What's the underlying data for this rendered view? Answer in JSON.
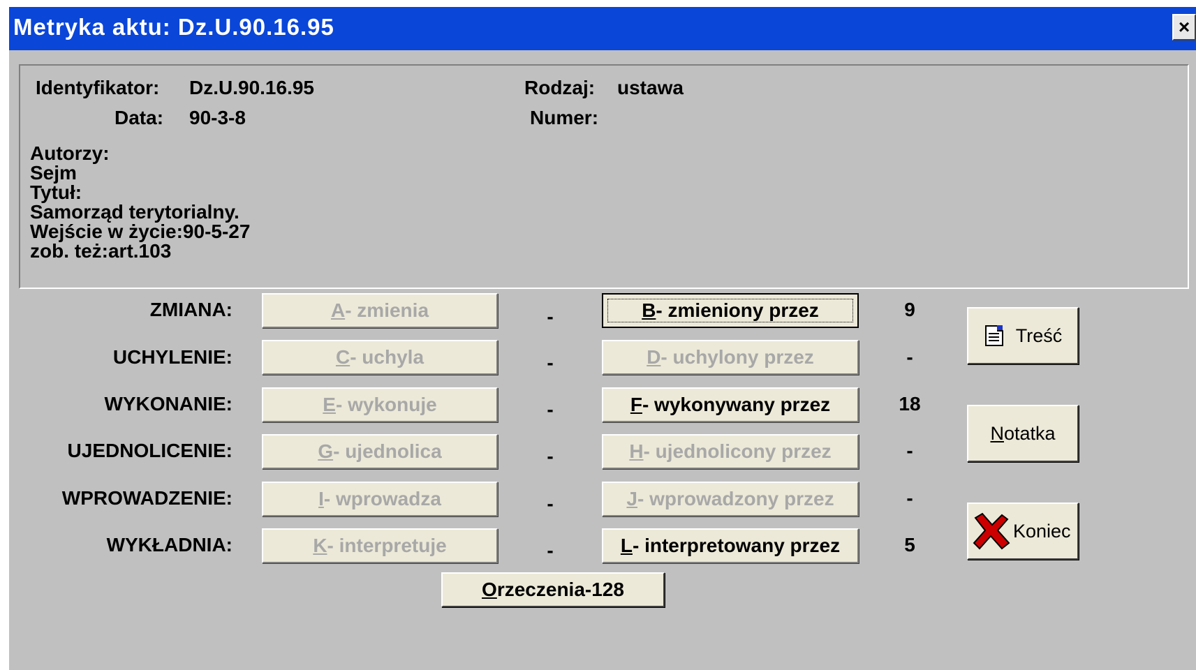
{
  "window": {
    "title": "Metryka aktu: Dz.U.90.16.95",
    "close_glyph": "×"
  },
  "info": {
    "identyfikator_label": "Identyfikator:",
    "identyfikator_value": "Dz.U.90.16.95",
    "data_label": "Data:",
    "data_value": "90-3-8",
    "rodzaj_label": "Rodzaj:",
    "rodzaj_value": "ustawa",
    "numer_label": "Numer:",
    "numer_value": "",
    "description_lines": [
      "Autorzy:",
      "Sejm",
      "Tytuł:",
      "Samorząd terytorialny.",
      "Wejście w życie:90-5-27",
      "zob. też:art.103"
    ]
  },
  "rows": [
    {
      "label": "ZMIANA:",
      "left_key": "A",
      "left_text": " - zmienia",
      "left_count": "-",
      "right_key": "B",
      "right_text": " - zmieniony przez",
      "right_count": "9"
    },
    {
      "label": "UCHYLENIE:",
      "left_key": "C",
      "left_text": " - uchyla",
      "left_count": "-",
      "right_key": "D",
      "right_text": " - uchylony przez",
      "right_count": "-"
    },
    {
      "label": "WYKONANIE:",
      "left_key": "E",
      "left_text": " - wykonuje",
      "left_count": "-",
      "right_key": "F",
      "right_text": " - wykonywany przez",
      "right_count": "18"
    },
    {
      "label": "UJEDNOLICENIE:",
      "left_key": "G",
      "left_text": " - ujednolica",
      "left_count": "-",
      "right_key": "H",
      "right_text": " - ujednolicony przez",
      "right_count": "-"
    },
    {
      "label": "WPROWADZENIE:",
      "left_key": "I",
      "left_text": " - wprowadza",
      "left_count": "-",
      "right_key": "J",
      "right_text": " - wprowadzony przez",
      "right_count": "-"
    },
    {
      "label": "WYKŁADNIA:",
      "left_key": "K",
      "left_text": " - interpretuje",
      "left_count": "-",
      "right_key": "L",
      "right_text": " - interpretowany przez",
      "right_count": "5"
    }
  ],
  "buttons": {
    "orzeczenia_key": "O",
    "orzeczenia_rest": "rzeczenia-128",
    "tresc_label": "Treść",
    "notatka_key": "N",
    "notatka_rest": "otatka",
    "koniec_label": "Koniec"
  },
  "colors": {
    "title_bar": "#0a46d8",
    "dialog_bg": "#c0c0c0",
    "button_face": "#ece9d8",
    "disabled_text": "#a8a8a8",
    "close_x": "#cc0000"
  },
  "icons": {
    "tresc": "document-icon",
    "koniec": "red-x-icon"
  }
}
